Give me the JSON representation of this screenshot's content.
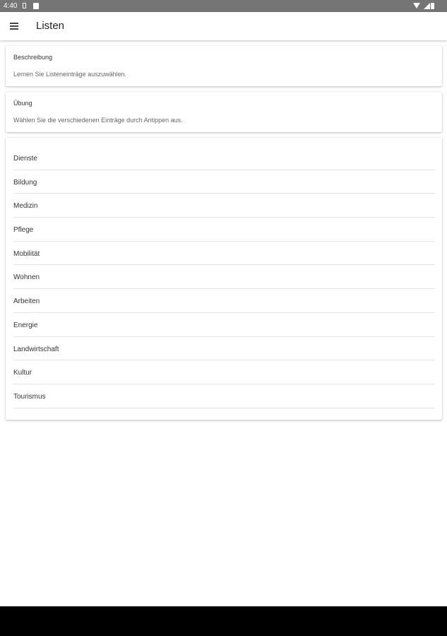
{
  "status_bar": {
    "time": "4:40",
    "icons": [
      "sim-card-icon",
      "sd-card-icon",
      "wifi-icon",
      "signal-icon",
      "battery-icon"
    ]
  },
  "app_bar": {
    "title": "Listen",
    "menu_icon": "hamburger-menu-icon"
  },
  "description_card": {
    "heading": "Beschreibung",
    "text": "Lernen Sie Listeneinträge auszuwählen."
  },
  "exercise_card": {
    "heading": "Übung",
    "text": "Wählen Sie die verschiedenen Einträge durch Antippen aus."
  },
  "list": {
    "items": [
      "Dienste",
      "Bildung",
      "Medizin",
      "Pflege",
      "Mobilität",
      "Wohnen",
      "Arbeiten",
      "Energie",
      "Landwirtschaft",
      "Kultur",
      "Tourismus"
    ]
  },
  "colors": {
    "status_bar": "#757575",
    "app_bar": "#ffffff",
    "nav_bar": "#000000",
    "divider": "#e3e3e3"
  }
}
